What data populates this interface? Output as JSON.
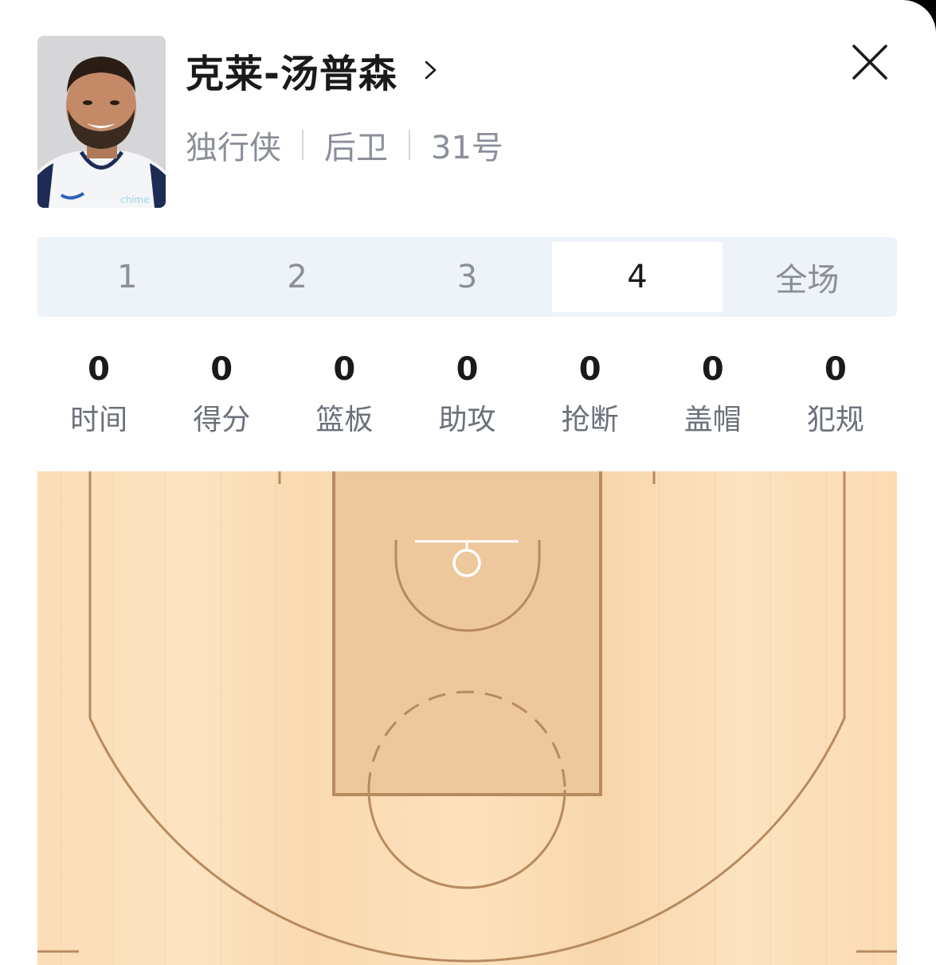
{
  "player": {
    "name": "克莱-汤普森",
    "team": "独行侠",
    "position": "后卫",
    "number": "31号",
    "jersey_sponsor": "chime"
  },
  "period_tabs": {
    "items": [
      "1",
      "2",
      "3",
      "4",
      "全场"
    ],
    "active": "4"
  },
  "stats": [
    {
      "value": "0",
      "label": "时间"
    },
    {
      "value": "0",
      "label": "得分"
    },
    {
      "value": "0",
      "label": "篮板"
    },
    {
      "value": "0",
      "label": "助攻"
    },
    {
      "value": "0",
      "label": "抢断"
    },
    {
      "value": "0",
      "label": "盖帽"
    },
    {
      "value": "0",
      "label": "犯规"
    }
  ],
  "colors": {
    "court_wood": "#fbddb6",
    "court_paint": "#edc89c",
    "court_line": "#b78a5f",
    "active_tab_bg": "#ffffff",
    "tabs_bg": "#eef2f9"
  },
  "icons": {
    "name_link": "chevron-right-icon",
    "close": "close-icon"
  }
}
